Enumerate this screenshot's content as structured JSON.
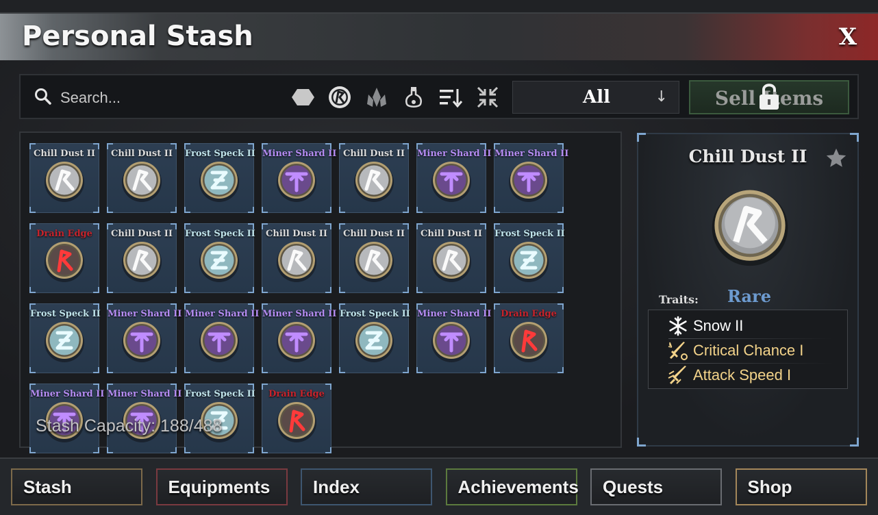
{
  "window": {
    "title": "Personal Stash",
    "close_label": "X"
  },
  "toolbar": {
    "search_placeholder": "Search...",
    "icons": [
      "shape-filter-icon",
      "rune-filter-icon",
      "material-filter-icon",
      "potion-filter-icon",
      "sort-icon",
      "collapse-icon"
    ],
    "filter_value": "All",
    "sell_label": "Sell Items"
  },
  "colors": {
    "chill": "#dcdcdc",
    "frost": "#bfe3ea",
    "miner": "#b58cf2",
    "drain": "#c7232b",
    "rarity": "#6d9bd0",
    "trait_gold": "#f3d38a",
    "trait_white": "#ffffff"
  },
  "grid": {
    "items": [
      {
        "name": "Chill Dust II",
        "kind": "chill"
      },
      {
        "name": "Chill Dust II",
        "kind": "chill"
      },
      {
        "name": "Frost Speck II",
        "kind": "frost"
      },
      {
        "name": "Miner Shard II",
        "kind": "miner"
      },
      {
        "name": "Chill Dust II",
        "kind": "chill"
      },
      {
        "name": "Miner Shard II",
        "kind": "miner"
      },
      {
        "name": "Miner Shard II",
        "kind": "miner"
      },
      {
        "name": "Drain Edge",
        "kind": "drain"
      },
      {
        "name": "Chill Dust II",
        "kind": "chill"
      },
      {
        "name": "Frost Speck II",
        "kind": "frost"
      },
      {
        "name": "Chill Dust II",
        "kind": "chill"
      },
      {
        "name": "Chill Dust II",
        "kind": "chill"
      },
      {
        "name": "Chill Dust II",
        "kind": "chill"
      },
      {
        "name": "Frost Speck II",
        "kind": "frost"
      },
      {
        "name": "Frost Speck II",
        "kind": "frost"
      },
      {
        "name": "Miner Shard II",
        "kind": "miner"
      },
      {
        "name": "Miner Shard II",
        "kind": "miner"
      },
      {
        "name": "Miner Shard II",
        "kind": "miner"
      },
      {
        "name": "Frost Speck II",
        "kind": "frost"
      },
      {
        "name": "Miner Shard II",
        "kind": "miner"
      },
      {
        "name": "Drain Edge",
        "kind": "drain"
      },
      {
        "name": "Miner Shard II",
        "kind": "miner"
      },
      {
        "name": "Miner Shard II",
        "kind": "miner"
      },
      {
        "name": "Frost Speck II",
        "kind": "frost"
      },
      {
        "name": "Drain Edge",
        "kind": "drain"
      }
    ],
    "capacity_label": "Stash Capacity: 188/488"
  },
  "detail": {
    "name": "Chill Dust II",
    "traits_label": "Traits:",
    "rarity": "Rare",
    "traits": [
      {
        "label": "Snow II",
        "icon": "snowflake-icon",
        "color": "#ffffff"
      },
      {
        "label": "Critical Chance I",
        "icon": "sword-crit-icon",
        "color": "#f3d38a"
      },
      {
        "label": "Attack Speed I",
        "icon": "sword-speed-icon",
        "color": "#f3d38a"
      }
    ]
  },
  "tabs": [
    {
      "label": "Stash",
      "border": "#7d6a4a"
    },
    {
      "label": "Equipments",
      "border": "#7a3a40"
    },
    {
      "label": "Index",
      "border": "#3e5670"
    },
    {
      "label": "Achievements",
      "border": "#5c7a3e"
    },
    {
      "label": "Quests",
      "border": "#6a6d72"
    },
    {
      "label": "Shop",
      "border": "#a4875a"
    }
  ]
}
